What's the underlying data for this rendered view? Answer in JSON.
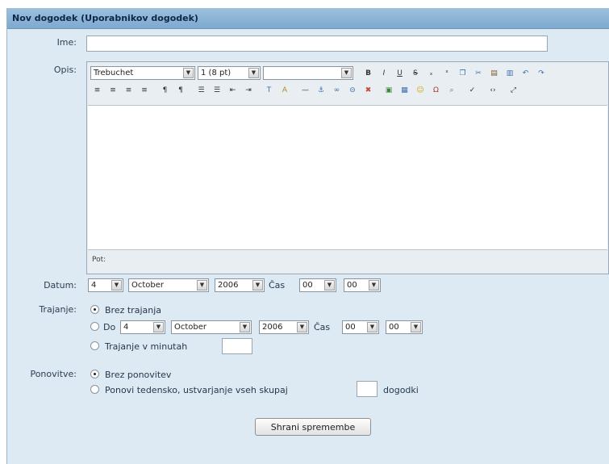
{
  "window": {
    "title": "Nov dogodek (Uporabnikov dogodek)"
  },
  "form": {
    "name_label": "Ime:",
    "name_value": "",
    "desc_label": "Opis:",
    "editor": {
      "font_value": "Trebuchet",
      "size_value": "1 (8 pt)",
      "style_value": "",
      "path_label": "Pot:"
    },
    "date": {
      "label": "Datum:",
      "day": "4",
      "month": "October",
      "year": "2006",
      "time_label": "Čas",
      "hour": "00",
      "minute": "00"
    },
    "duration": {
      "label": "Trajanje:",
      "opt_none": "Brez trajanja",
      "opt_until": "Do",
      "day": "4",
      "month": "October",
      "year": "2006",
      "time_label": "Čas",
      "hour": "00",
      "minute": "00",
      "opt_minutes": "Trajanje v minutah",
      "minutes_value": ""
    },
    "repeat": {
      "label": "Ponovitve:",
      "opt_none": "Brez ponovitev",
      "opt_weekly": "Ponovi tedensko, ustvarjanje vseh skupaj",
      "count_value": "",
      "suffix": "dogodki"
    },
    "save_label": "Shrani spremembe"
  }
}
